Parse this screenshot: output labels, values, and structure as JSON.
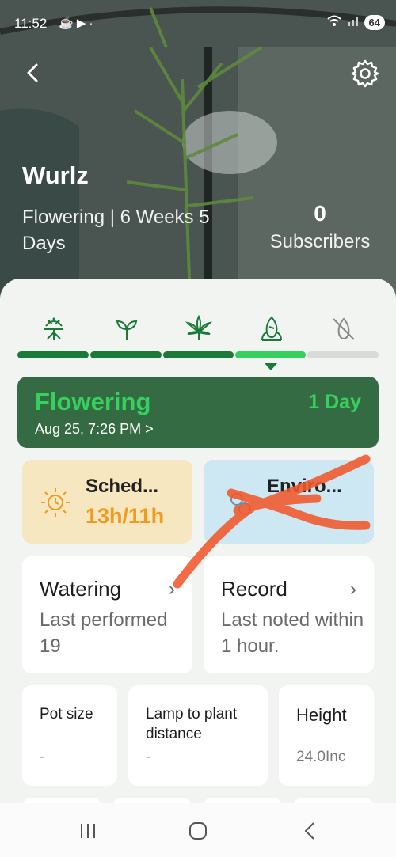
{
  "status_bar": {
    "time": "11:52",
    "battery": "64"
  },
  "plant": {
    "name": "Wurlz",
    "stage_line": "Flowering | 6 Weeks 5 Days",
    "subscriber_count": "0",
    "subscriber_label": "Subscribers"
  },
  "stage_icons": [
    "germination-icon",
    "seedling-icon",
    "vegetative-leaf-icon",
    "flowering-bud-icon",
    "harvest-disabled-icon"
  ],
  "current_stage": {
    "title": "Flowering",
    "days": "1 Day",
    "date": "Aug 25, 7:26 PM >"
  },
  "schedule": {
    "title": "Sched...",
    "value": "13h/11h"
  },
  "environment": {
    "title": "Enviro..."
  },
  "watering": {
    "title": "Watering",
    "subtitle": "Last performed 19"
  },
  "record": {
    "title": "Record",
    "subtitle": "Last noted within 1 hour."
  },
  "pot_size": {
    "title": "Pot size",
    "value": "-"
  },
  "lamp_distance": {
    "title": "Lamp to plant distance",
    "value": "-"
  },
  "height": {
    "title": "Height",
    "value": "24.0Inc"
  },
  "colors": {
    "accent_green": "#35d05e",
    "dark_green": "#356b42",
    "schedule_orange": "#f29a1c",
    "annotation": "#f2582b"
  }
}
